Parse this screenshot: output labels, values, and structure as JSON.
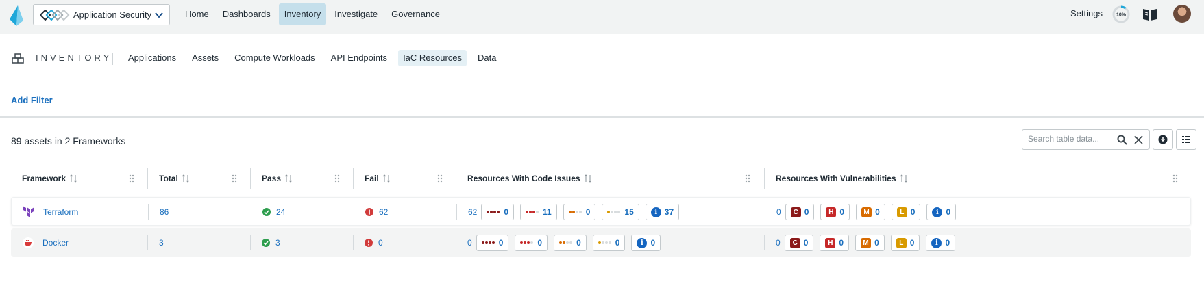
{
  "app": {
    "selector_label": "Application Security"
  },
  "topnav": {
    "items": [
      "Home",
      "Dashboards",
      "Inventory",
      "Investigate",
      "Governance"
    ],
    "active": "Inventory"
  },
  "header_right": {
    "settings": "Settings",
    "progress": "10%"
  },
  "inventory": {
    "title": "INVENTORY",
    "tabs": [
      "Applications",
      "Assets",
      "Compute Workloads",
      "API Endpoints",
      "IaC Resources",
      "Data"
    ],
    "active_tab": "IaC Resources"
  },
  "filter": {
    "add_label": "Add Filter"
  },
  "summary": "89 assets in 2 Frameworks",
  "search": {
    "placeholder": "Search table data..."
  },
  "table": {
    "columns": [
      "Framework",
      "Total",
      "Pass",
      "Fail",
      "Resources With Code Issues",
      "Resources With Vulnerabilities"
    ],
    "rows": [
      {
        "framework": "Terraform",
        "total": "86",
        "pass": "24",
        "fail": "62",
        "code_total": "62",
        "code_critical": "0",
        "code_high": "11",
        "code_medium": "0",
        "code_low": "15",
        "code_info": "37",
        "vuln_total": "0",
        "vuln_c": "0",
        "vuln_h": "0",
        "vuln_m": "0",
        "vuln_l": "0",
        "vuln_i": "0"
      },
      {
        "framework": "Docker",
        "total": "3",
        "pass": "3",
        "fail": "0",
        "code_total": "0",
        "code_critical": "0",
        "code_high": "0",
        "code_medium": "0",
        "code_low": "0",
        "code_info": "0",
        "vuln_total": "0",
        "vuln_c": "0",
        "vuln_h": "0",
        "vuln_m": "0",
        "vuln_l": "0",
        "vuln_i": "0"
      }
    ]
  },
  "severity_badges": {
    "critical": "C",
    "high": "H",
    "medium": "M",
    "low": "L",
    "info": "i"
  },
  "colors": {
    "critical": "#8b1a1a",
    "high": "#c62828",
    "medium": "#d86b00",
    "low": "#d89a00",
    "info": "#1565c0",
    "link": "#1a6fbe",
    "active_nav": "#c5dfeb",
    "terraform": "#7b42bc",
    "docker": "#d93a3a"
  }
}
